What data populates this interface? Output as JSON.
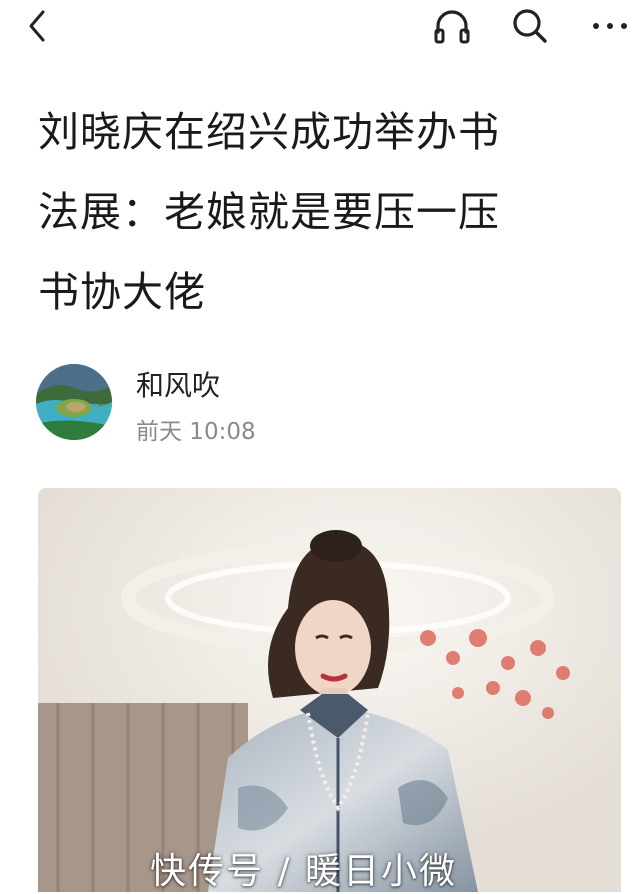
{
  "toolbar": {
    "icons": [
      "back-icon",
      "headphones-icon",
      "search-icon",
      "more-icon"
    ]
  },
  "article": {
    "title_lines": [
      "刘晓庆在绍兴成功举办书",
      "法展：老娘就是要压一压",
      "书协大佬"
    ]
  },
  "author": {
    "name": "和风吹",
    "time": "前天 10:08"
  },
  "image": {
    "watermark": "快传号 / 暖日小微"
  }
}
